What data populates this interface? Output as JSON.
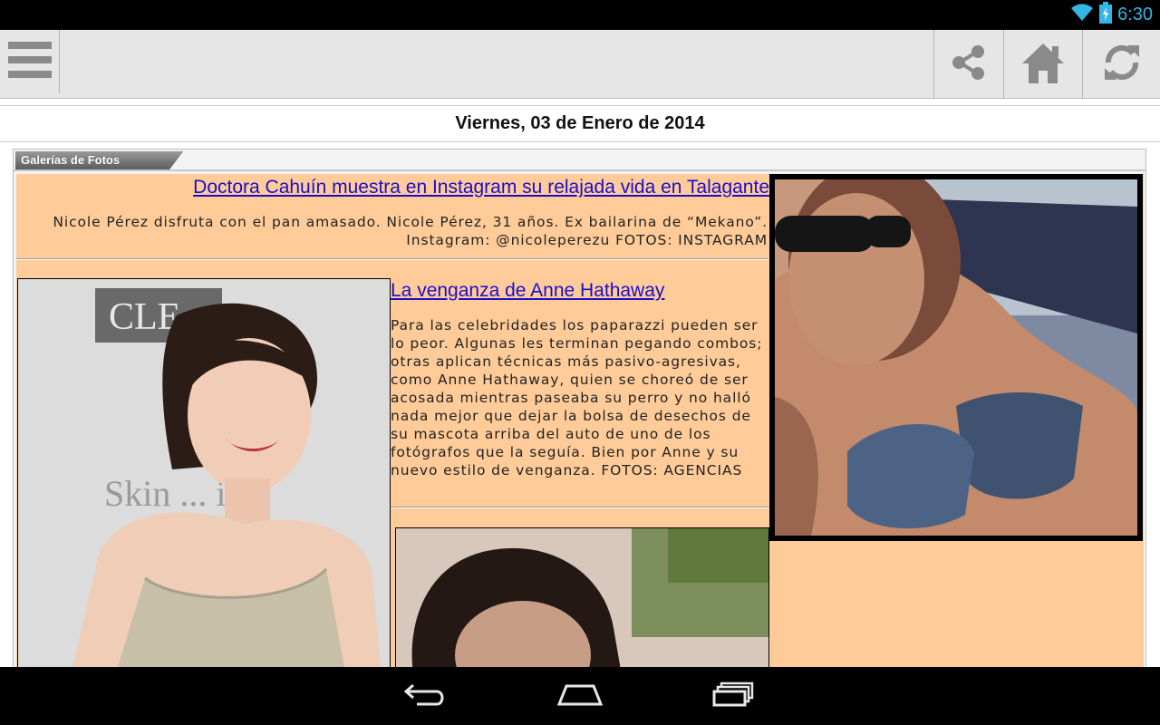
{
  "status_bar": {
    "time": "6:30",
    "icons": [
      "wifi-icon",
      "battery-charging-icon"
    ]
  },
  "toolbar": {
    "left_icon": "menu-icon",
    "right_icons": [
      "share-icon",
      "home-icon",
      "refresh-icon"
    ]
  },
  "date": "Viernes, 03 de Enero de 2014",
  "gallery": {
    "tab_label": "Galerías de Fotos"
  },
  "articles": [
    {
      "title": "Doctora Cahuín muestra en Instagram su relajada vida en Talagante",
      "description": "Nicole Pérez disfruta con el pan amasado. Nicole Pérez, 31 años. Ex bailarina de “Mekano”. Instagram: @nicoleperezu FOTOS: INSTAGRAM"
    },
    {
      "title": "La venganza de Anne Hathaway",
      "description": "Para las celebridades los paparazzi pueden ser lo peor. Algunas les terminan pegando combos; otras aplican técnicas más pasivo-agresivas, como Anne Hathaway, quien se choreó de ser acosada mientras paseaba su perro y no halló nada mejor que dejar la bolsa de desechos de su mascota arriba del auto de uno de los fotógrafos que la seguía. Bien por Anne y su nuevo estilo de venganza. FOTOS: AGENCIAS"
    }
  ],
  "photos": {
    "backdrop_text": "Skin ... irl",
    "logo_text": "CLE"
  },
  "nav_bar": {
    "icons": [
      "back-icon",
      "home-nav-icon",
      "recent-apps-icon"
    ]
  },
  "colors": {
    "accent_time": "#33b5e5",
    "link": "#1a0dcc",
    "panel_bg": "#ffcc99"
  }
}
